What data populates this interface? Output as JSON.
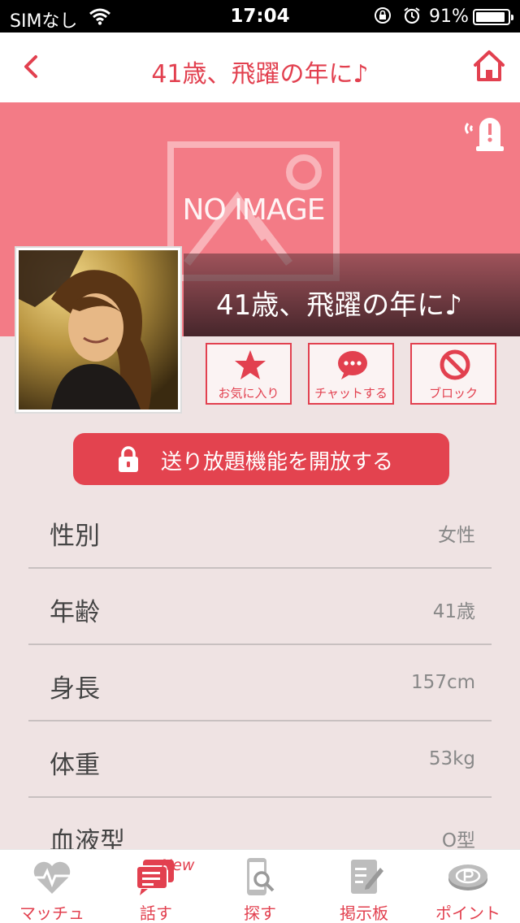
{
  "status_bar": {
    "carrier": "SIMなし",
    "time": "17:04",
    "battery": "91%",
    "battery_level": 0.91
  },
  "navbar": {
    "title": "41歳、飛躍の年に♪",
    "back_icon": "chevron-left-icon",
    "home_icon": "home-icon"
  },
  "cover": {
    "placeholder": "NO IMAGE",
    "display_name": "41歳、飛躍の年に♪",
    "report_icon": "alert-icon"
  },
  "actions": [
    {
      "label": "お気に入り",
      "icon": "star-icon"
    },
    {
      "label": "チャットする",
      "icon": "chat-bubble-icon"
    },
    {
      "label": "ブロック",
      "icon": "block-icon"
    }
  ],
  "unlock_button": {
    "label": "送り放題機能を開放する",
    "icon": "lock-icon"
  },
  "profile_rows": [
    {
      "key": "性別",
      "value": "女性"
    },
    {
      "key": "年齢",
      "value": "41歳"
    },
    {
      "key": "身長",
      "value": "157cm"
    },
    {
      "key": "体重",
      "value": "53kg"
    },
    {
      "key": "血液型",
      "value": "O型"
    }
  ],
  "tabbar": {
    "tabs": [
      {
        "label": "マッチュ",
        "icon": "heart-pulse-icon"
      },
      {
        "label": "話す",
        "icon": "chat-icon",
        "badge": "New"
      },
      {
        "label": "探す",
        "icon": "phone-search-icon"
      },
      {
        "label": "掲示板",
        "icon": "board-edit-icon"
      },
      {
        "label": "ポイント",
        "icon": "point-coin-icon"
      }
    ]
  },
  "colors": {
    "accent": "#e2404f",
    "cover": "#f37b86",
    "background": "#efe3e3"
  }
}
